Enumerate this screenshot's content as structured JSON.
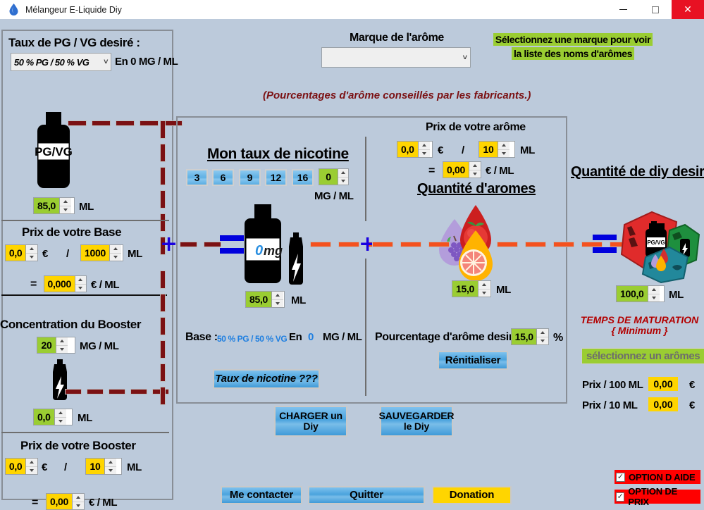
{
  "window": {
    "title": "Mélangeur E-Liquide Diy",
    "icon": "droplet-icon",
    "minimize_label": "—",
    "maximize_label": "□",
    "close_label": "✕",
    "accent_close": "#e81123"
  },
  "left_panel": {
    "pgvg_title": "Taux de PG / VG desiré :",
    "pgvg_select_value": "50 % PG / 50 % VG",
    "pgvg_suffix": "En 0 MG / ML",
    "bottle_label": "PG/VG",
    "base_ml_value": "85,0",
    "base_ml_unit": "ML",
    "base_price_title": "Prix de votre Base",
    "base_price_value": "0,0",
    "base_price_currency": "€",
    "base_price_sep": "/",
    "base_price_qty": "1000",
    "base_price_qty_unit": "ML",
    "base_unit_eq": "=",
    "base_unit_value": "0,000",
    "base_unit_label": "€ / ML",
    "booster_title": "Concentration du Booster",
    "booster_conc_value": "20",
    "booster_conc_unit": "MG / ML",
    "booster_ml_value": "0,0",
    "booster_ml_unit": "ML",
    "booster_price_title": "Prix de votre Booster",
    "booster_price_value": "0,0",
    "booster_price_currency": "€",
    "booster_price_sep": "/",
    "booster_price_qty": "10",
    "booster_price_qty_unit": "ML",
    "booster_unit_eq": "=",
    "booster_unit_value": "0,00",
    "booster_unit_label": "€ / ML"
  },
  "top": {
    "brand_title": "Marque de l'arôme",
    "brand_value": "",
    "brand_chevron": "chevron-down-icon",
    "hint_line1": "Sélectionnez une marque pour voir",
    "hint_line2": "la liste des noms d'arômes",
    "advice": "(Pourcentages d'arôme conseillés par les fabricants.)"
  },
  "nicotine": {
    "title": "Mon taux de nicotine",
    "presets": [
      "3",
      "6",
      "9",
      "12",
      "16"
    ],
    "value": "0",
    "unit": "MG / ML",
    "bottle_text_num": "0",
    "bottle_text_unit": "mg",
    "ml_value": "85,0",
    "ml_unit": "ML",
    "base_label": "Base :",
    "base_ratio": "50 % PG / 50 % VG",
    "base_en": "En",
    "base_mg": "0",
    "base_unit": "MG / ML",
    "rate_button": "Taux de nicotine ???"
  },
  "aroma": {
    "price_title": "Prix de votre arôme",
    "price_value": "0,0",
    "price_currency": "€",
    "price_sep": "/",
    "price_qty": "10",
    "price_qty_unit": "ML",
    "unit_eq": "=",
    "unit_value": "0,00",
    "unit_label": "€ / ML",
    "qty_title": "Quantité d'aromes",
    "qty_value": "15,0",
    "qty_unit": "ML",
    "pct_label": "Pourcentage  d'arôme desiré:",
    "pct_value": "15,0",
    "pct_unit": "%",
    "reset_button": "Rénitialiser"
  },
  "diy": {
    "title": "Quantité de diy desirée",
    "qty_value": "100,0",
    "qty_unit": "ML",
    "maturation_line1": "TEMPS DE MATURATION",
    "maturation_line2": "{ Minimum }",
    "maturation_status": "sélectionnez un arômes",
    "price100_label": "Prix / 100 ML",
    "price100_value": "0,00",
    "price100_currency": "€",
    "price10_label": "Prix / 10 ML",
    "price10_value": "0,00",
    "price10_currency": "€"
  },
  "actions": {
    "load_line1": "CHARGER  un",
    "load_line2": "Diy",
    "save_line1": "SAUVEGARDER",
    "save_line2": "le Diy",
    "contact": "Me contacter",
    "quit": "Quitter",
    "donation": "Donation"
  },
  "options": {
    "help_label": "OPTION D AIDE",
    "help_checked": "✓",
    "price_label": "OPTION DE PRIX",
    "price_checked": "✓"
  },
  "colors": {
    "background": "#bccadb",
    "green_field": "#9acd32",
    "yellow_field": "#ffd500",
    "blue_button": "#5fb0e4",
    "red_option": "#ff0000",
    "dark_red_dash": "#7b1113",
    "orange_dash": "#f4511e",
    "blue_marker": "#0000dd"
  }
}
